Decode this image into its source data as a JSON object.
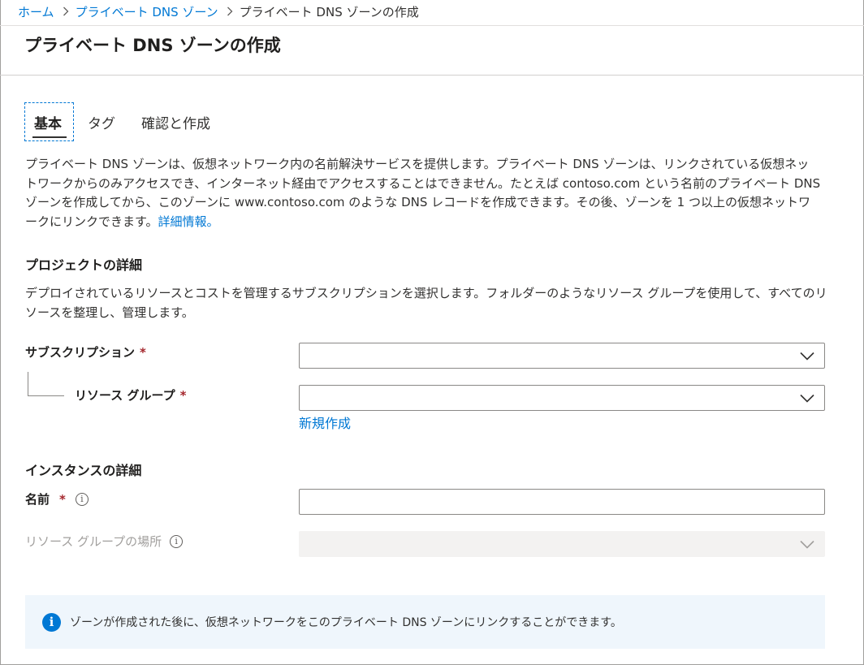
{
  "breadcrumb": {
    "items": [
      "ホーム",
      "プライベート DNS ゾーン"
    ],
    "current": "プライベート DNS ゾーンの作成"
  },
  "page": {
    "title": "プライベート DNS ゾーンの作成"
  },
  "tabs": [
    {
      "label": "基本",
      "selected": true
    },
    {
      "label": "タグ",
      "selected": false
    },
    {
      "label": "確認と作成",
      "selected": false
    }
  ],
  "description": {
    "text": "プライベート DNS ゾーンは、仮想ネットワーク内の名前解決サービスを提供します。プライベート DNS ゾーンは、リンクされている仮想ネットワークからのみアクセスでき、インターネット経由でアクセスすることはできません。たとえば contoso.com という名前のプライベート DNS ゾーンを作成してから、このゾーンに www.contoso.com のような DNS レコードを作成できます。その後、ゾーンを 1 つ以上の仮想ネットワークにリンクできます。",
    "learn_more": "詳細情報。"
  },
  "project": {
    "title": "プロジェクトの詳細",
    "description": "デプロイされているリソースとコストを管理するサブスクリプションを選択します。フォルダーのようなリソース グループを使用して、すべてのリソースを整理し、管理します。",
    "subscription_label": "サブスクリプション",
    "subscription_value": "",
    "resource_group_label": "リソース グループ",
    "resource_group_value": "",
    "create_new": "新規作成"
  },
  "instance": {
    "title": "インスタンスの詳細",
    "name_label": "名前",
    "name_value": "",
    "location_label": "リソース グループの場所",
    "location_value": ""
  },
  "required_marker": "*",
  "info_glyph": "i",
  "info_bar": {
    "message": "ゾーンが作成された後に、仮想ネットワークをこのプライベート DNS ゾーンにリンクすることができます。"
  },
  "colors": {
    "accent": "#0078d4",
    "required": "#a4262c",
    "info_background": "#eff6fc"
  },
  "icons": {
    "breadcrumb_separator": "chevron-right-icon",
    "dropdown": "chevron-down-icon",
    "info": "info-icon"
  }
}
